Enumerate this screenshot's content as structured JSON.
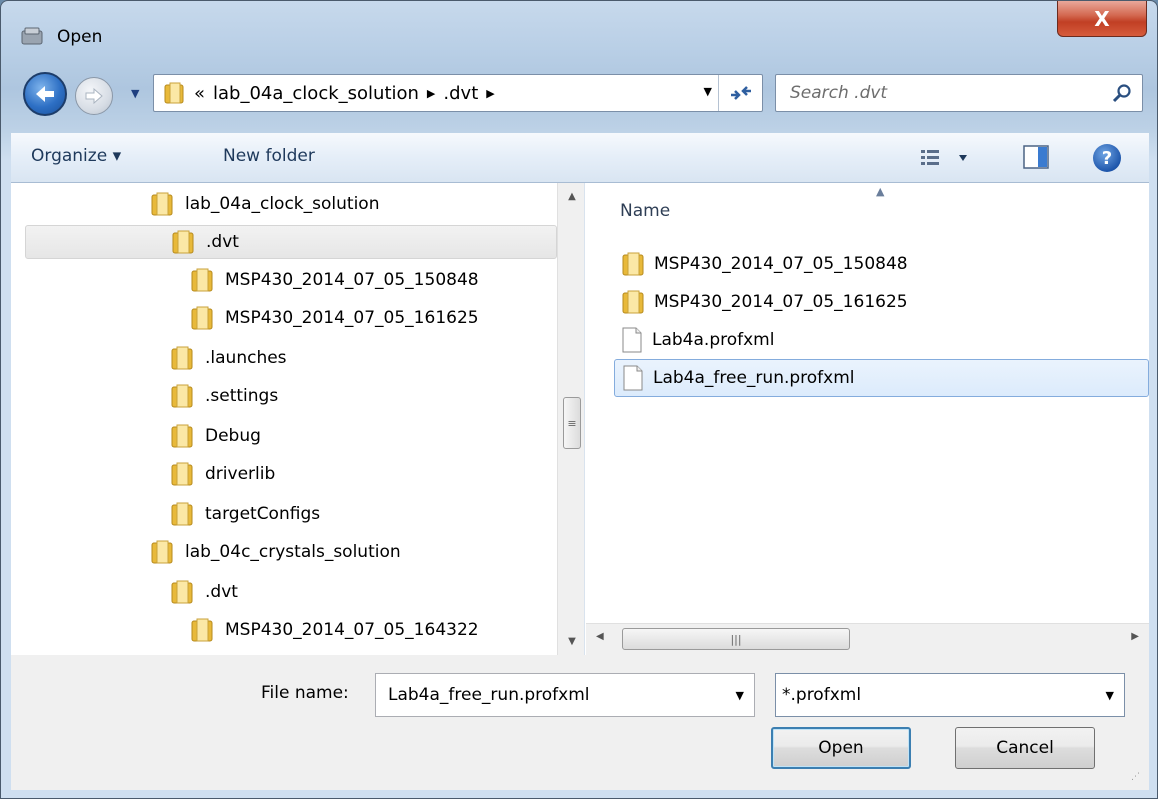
{
  "window": {
    "title": "Open",
    "close_symbol": "X"
  },
  "address": {
    "overflow": "«",
    "segments": [
      "lab_04a_clock_solution",
      ".dvt"
    ],
    "separator": "▶"
  },
  "search": {
    "placeholder": "Search .dvt"
  },
  "toolbar": {
    "organize_label": "Organize ▾",
    "new_folder_label": "New folder",
    "help_symbol": "?"
  },
  "nav_tree": {
    "items": [
      {
        "label": "lab_04a_clock_solution"
      },
      {
        "label": ".dvt"
      },
      {
        "label": "MSP430_2014_07_05_150848"
      },
      {
        "label": "MSP430_2014_07_05_161625"
      },
      {
        "label": ".launches"
      },
      {
        "label": ".settings"
      },
      {
        "label": "Debug"
      },
      {
        "label": "driverlib"
      },
      {
        "label": "targetConfigs"
      },
      {
        "label": "lab_04c_crystals_solution"
      },
      {
        "label": ".dvt"
      },
      {
        "label": "MSP430_2014_07_05_164322"
      }
    ]
  },
  "file_list": {
    "column_name": "Name",
    "items": [
      {
        "label": "MSP430_2014_07_05_150848",
        "type": "folder"
      },
      {
        "label": "MSP430_2014_07_05_161625",
        "type": "folder"
      },
      {
        "label": "Lab4a.profxml",
        "type": "file"
      },
      {
        "label": "Lab4a_free_run.profxml",
        "type": "file"
      }
    ]
  },
  "footer": {
    "file_name_label": "File name:",
    "file_name_value": "Lab4a_free_run.profxml",
    "file_type_value": "*.profxml",
    "open_label": "Open",
    "cancel_label": "Cancel"
  },
  "colors": {
    "folder": "#e8b93a",
    "accent": "#3c7fb1"
  }
}
